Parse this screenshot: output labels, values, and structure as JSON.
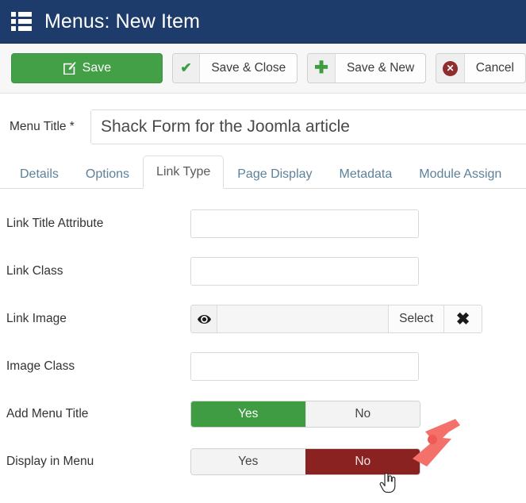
{
  "header": {
    "title": "Menus: New Item",
    "icon": "menu-list-icon",
    "bg_color": "#1e3c6b"
  },
  "toolbar": {
    "buttons": [
      {
        "label": "Save",
        "icon": "edit-pencil-icon",
        "style": "primary-green",
        "color": "#44a047"
      },
      {
        "label": "Save & Close",
        "icon": "check-icon",
        "style": "default"
      },
      {
        "label": "Save & New",
        "icon": "plus-icon",
        "style": "default"
      },
      {
        "label": "Cancel",
        "icon": "cancel-circle-icon",
        "style": "default"
      }
    ]
  },
  "menu_title": {
    "label": "Menu Title *",
    "value": "Shack Form for the Joomla article",
    "placeholder": ""
  },
  "tabs": [
    {
      "label": "Details",
      "active": false
    },
    {
      "label": "Options",
      "active": false
    },
    {
      "label": "Link Type",
      "active": true
    },
    {
      "label": "Page Display",
      "active": false
    },
    {
      "label": "Metadata",
      "active": false
    },
    {
      "label": "Module Assign",
      "active": false
    }
  ],
  "fields": {
    "link_title_attribute": {
      "label": "Link Title Attribute",
      "value": "",
      "placeholder": ""
    },
    "link_class": {
      "label": "Link Class",
      "value": "",
      "placeholder": ""
    },
    "link_image": {
      "label": "Link Image",
      "value": "",
      "placeholder": "",
      "eye_icon": "eye-icon",
      "select_label": "Select",
      "clear_label": "✖"
    },
    "image_class": {
      "label": "Image Class",
      "value": "",
      "placeholder": ""
    },
    "add_menu_title": {
      "label": "Add Menu Title",
      "yes_label": "Yes",
      "no_label": "No",
      "selected": "Yes",
      "on_color": "#3f9c42"
    },
    "display_in_menu": {
      "label": "Display in Menu",
      "yes_label": "Yes",
      "no_label": "No",
      "selected": "No",
      "on_color": "#8b2222"
    }
  },
  "annotations": {
    "arrow": {
      "name": "red-arrow-annotation",
      "color": "#f4706a",
      "points_to": "Display in Menu No button"
    },
    "cursor": {
      "name": "hand-cursor",
      "over": "Display in Menu No button"
    }
  }
}
